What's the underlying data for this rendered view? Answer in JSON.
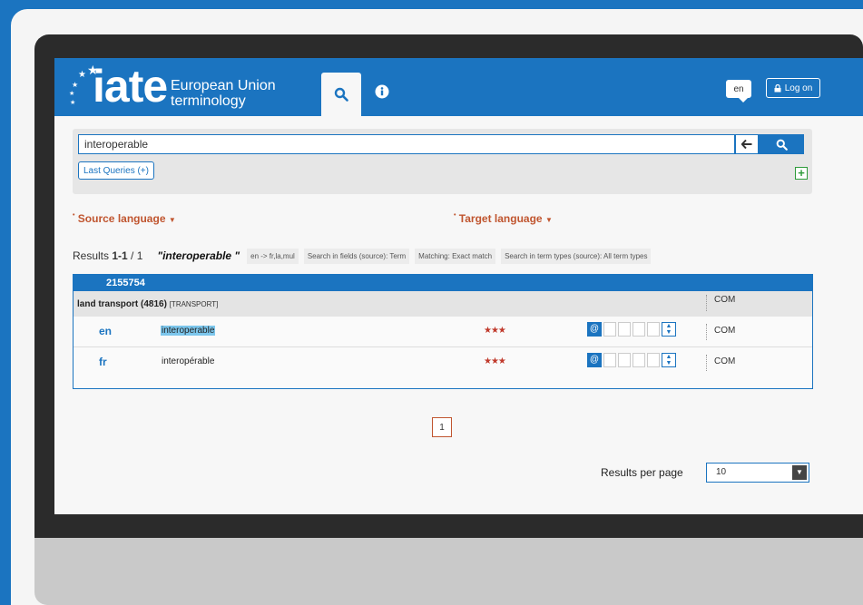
{
  "app": {
    "logo_text": "iate",
    "subtitle_line1": "European Union",
    "subtitle_line2": "terminology"
  },
  "header": {
    "search_tab_icon": "search-icon",
    "info_tab_icon": "info-icon",
    "language_label": "en",
    "logon_label": "Log on"
  },
  "search": {
    "query": "interoperable",
    "last_queries_label": "Last Queries (+)",
    "add_label": "+"
  },
  "filters": {
    "source_language_label": "Source language",
    "target_language_label": "Target language"
  },
  "results": {
    "count_prefix": "Results",
    "count_value": "1-1",
    "count_suffix": "/ 1",
    "query_echo": "\"interoperable \"",
    "chips": [
      "en -> fr,la,mul",
      "Search in fields (source): Term",
      "Matching: Exact match",
      "Search in term types (source): All term types"
    ],
    "entry": {
      "id": "2155754",
      "domain": "land transport (4816)",
      "domain_code": "[TRANSPORT]",
      "domain_com": "COM",
      "terms": [
        {
          "lang": "en",
          "term": "interoperable",
          "stars": "★★★",
          "com": "COM",
          "highlighted": true
        },
        {
          "lang": "fr",
          "term": "interopérable",
          "stars": "★★★",
          "com": "COM",
          "highlighted": false
        }
      ]
    }
  },
  "pagination": {
    "current_page": "1"
  },
  "results_per_page": {
    "label": "Results per page",
    "value": "10"
  },
  "colors": {
    "brand_blue": "#1b74c0",
    "accent_orange": "#c0552f",
    "stars_red": "#c0392b",
    "highlight": "#7cc6ec",
    "add_green": "#2e9b3a"
  }
}
